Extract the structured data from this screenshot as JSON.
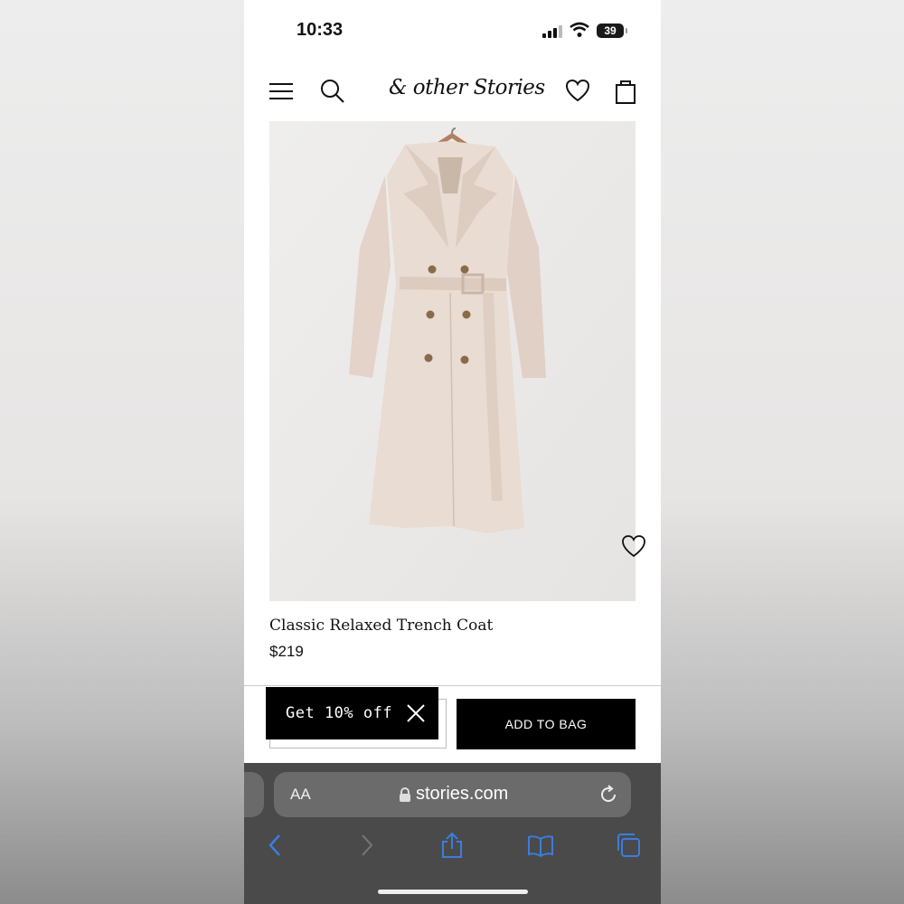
{
  "status_bar": {
    "time": "10:33",
    "battery": "39"
  },
  "nav": {
    "brand": "& other Stories"
  },
  "product": {
    "name": "Classic Relaxed Trench Coat",
    "price": "$219"
  },
  "promo": {
    "label": "Get 10% off"
  },
  "actions": {
    "add_to_bag": "ADD TO BAG"
  },
  "browser": {
    "text_size_label": "AA",
    "url": "stories.com"
  },
  "colors": {
    "coat": "#e8d8cc",
    "background": "#eceae8",
    "accent": "#3b7de0"
  }
}
